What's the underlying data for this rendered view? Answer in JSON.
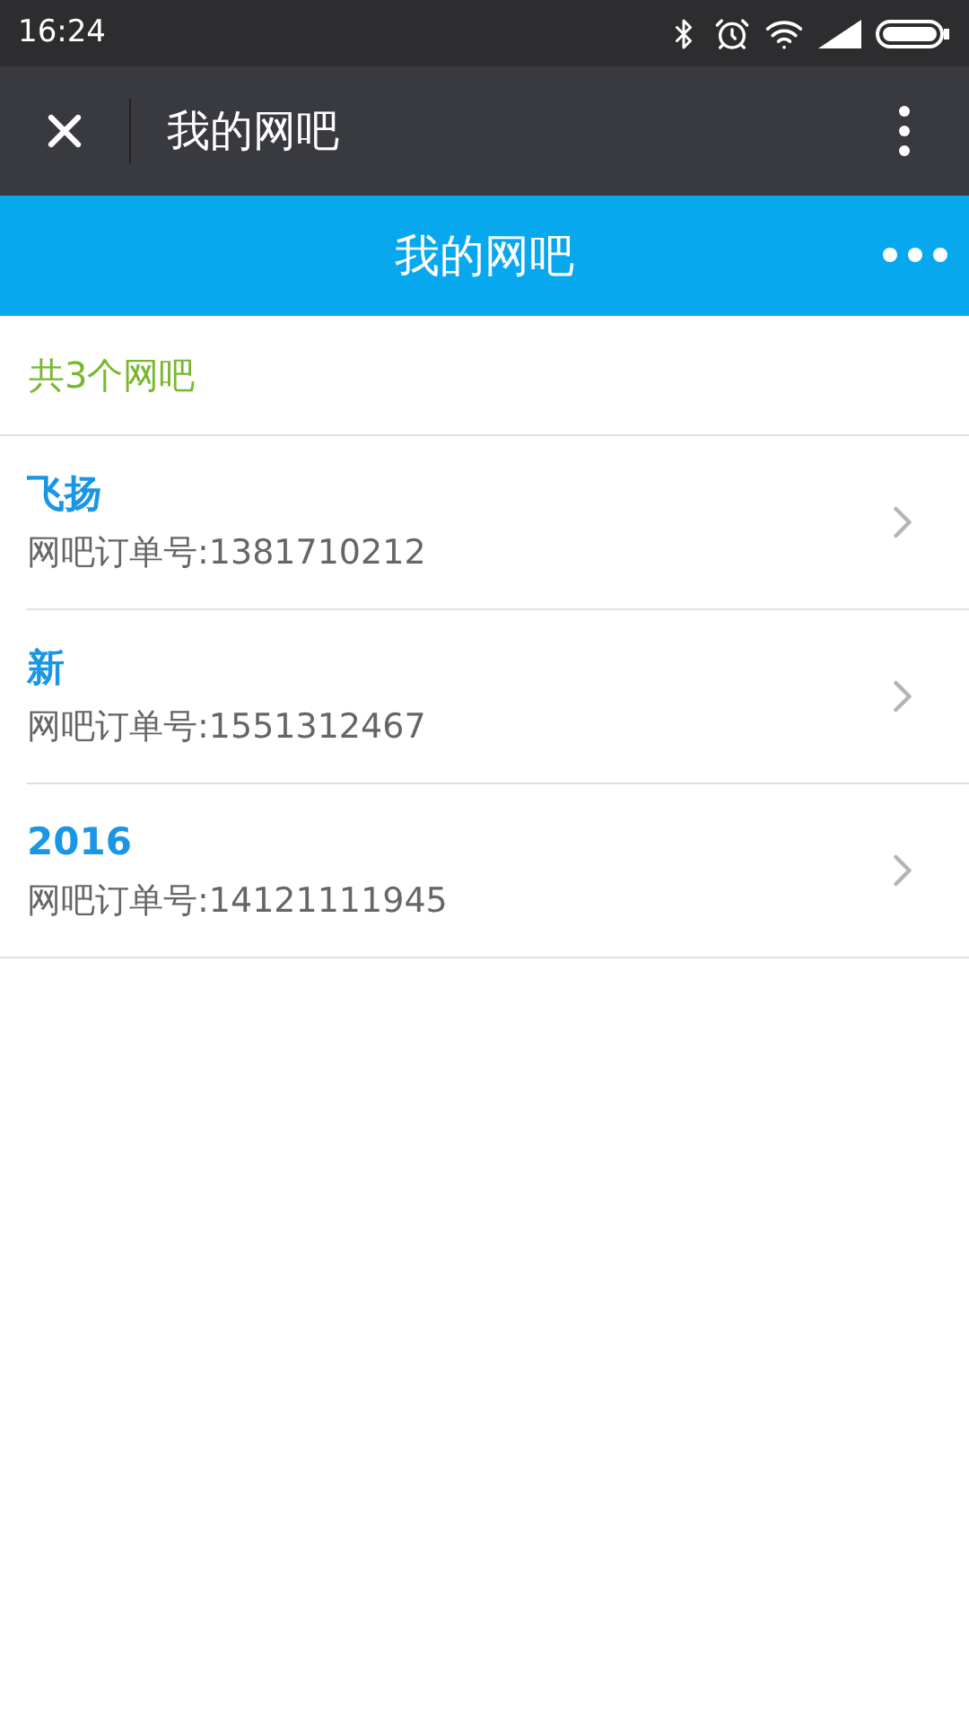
{
  "status_bar": {
    "time": "16:24"
  },
  "top_bar": {
    "title": "我的网吧"
  },
  "header": {
    "title": "我的网吧"
  },
  "summary": "共3个网吧",
  "cafes": [
    {
      "name": "飞扬",
      "order": "网吧订单号:1381710212"
    },
    {
      "name": "新",
      "order": "网吧订单号:1551312467"
    },
    {
      "name": "2016",
      "order": "网吧订单号:14121111945"
    }
  ]
}
